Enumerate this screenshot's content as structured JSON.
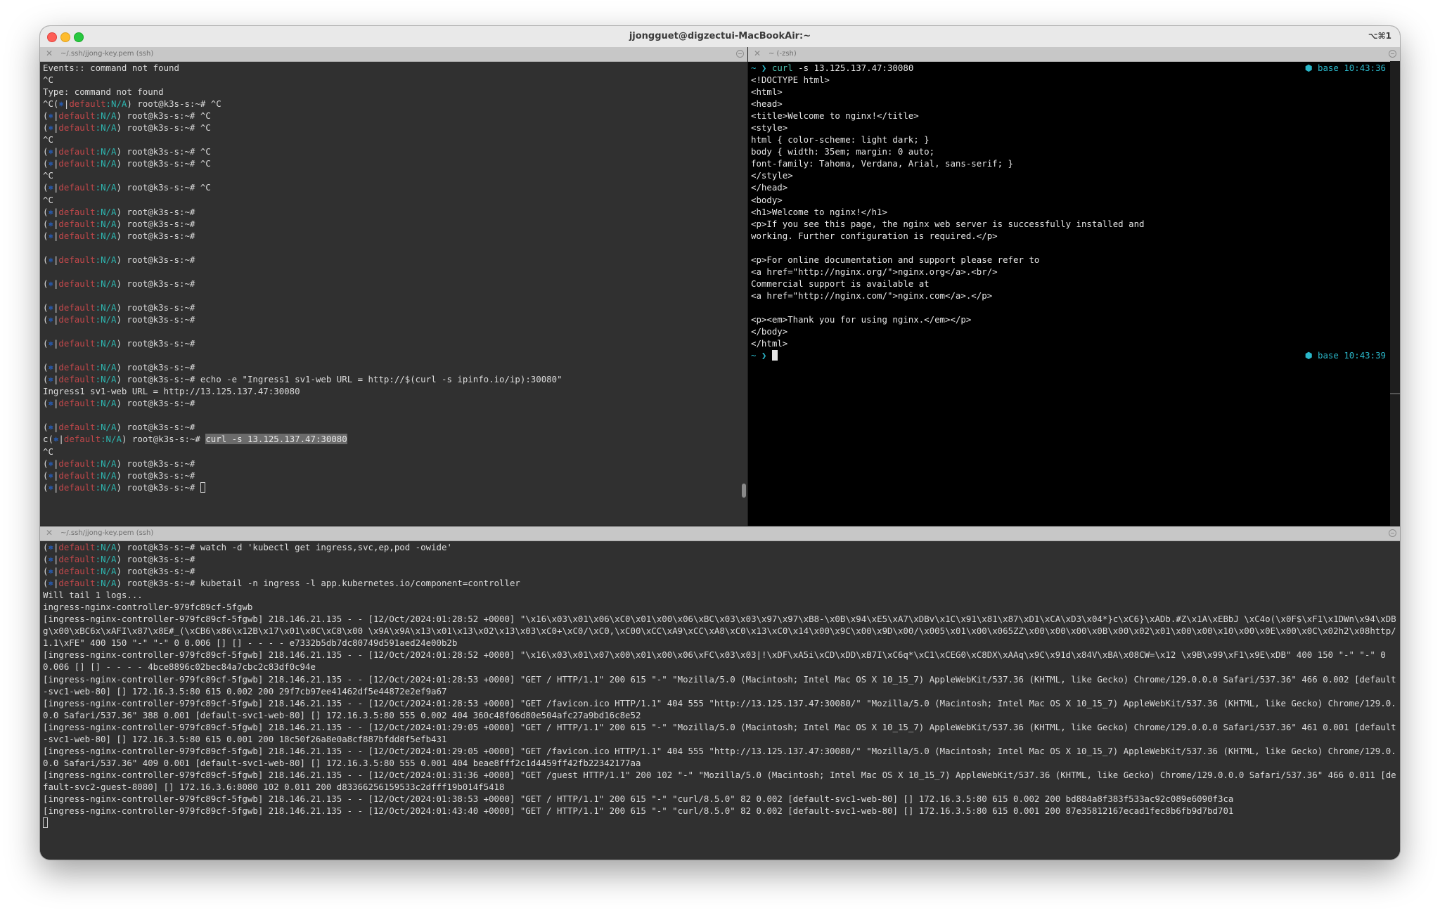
{
  "window": {
    "title": "jjongguet@digzectui-MacBookAir:~",
    "shortcut": "⌥⌘1"
  },
  "prompt": {
    "ctx_symbol": "⎈",
    "namespace": "default",
    "ns_suffix": ":N/A",
    "host": "root@k3s-s:~#"
  },
  "pane_left": {
    "tab_title": "~/.ssh/jjong-key.pem (ssh)",
    "pre_lines": [
      "Events:: command not found",
      "^C",
      "Type: command not found"
    ],
    "line4_prefix": "^C",
    "line4_suffix": " ^C",
    "after_c1": " ^C",
    "after_c2": " ^C",
    "echo_cmd": " echo -e \"Ingress1 sv1-web URL = http://$(curl -s ipinfo.io/ip):30080\"",
    "echo_output": "Ingress1 sv1-web URL = http://13.125.137.47:30080",
    "c_prefix": "c",
    "curl_cmd": "curl -s 13.125.137.47:30080",
    "ctrl_c": "^C"
  },
  "pane_right": {
    "tab_title": "~ (-zsh)",
    "prompt_symbol": "~ ❯",
    "command_name": "curl",
    "command_args": " -s 13.125.137.47:30080",
    "rprompt_env": "base",
    "rprompt_time1": "10:43:36",
    "rprompt_time2": "10:43:39",
    "html_lines": [
      "<!DOCTYPE html>",
      "<html>",
      "<head>",
      "<title>Welcome to nginx!</title>",
      "<style>",
      "html { color-scheme: light dark; }",
      "body { width: 35em; margin: 0 auto;",
      "font-family: Tahoma, Verdana, Arial, sans-serif; }",
      "</style>",
      "</head>",
      "<body>",
      "<h1>Welcome to nginx!</h1>",
      "<p>If you see this page, the nginx web server is successfully installed and",
      "working. Further configuration is required.</p>",
      "",
      "<p>For online documentation and support please refer to",
      "<a href=\"http://nginx.org/\">nginx.org</a>.<br/>",
      "Commercial support is available at",
      "<a href=\"http://nginx.com/\">nginx.com</a>.</p>",
      "",
      "<p><em>Thank you for using nginx.</em></p>",
      "</body>",
      "</html>"
    ]
  },
  "pane_bottom": {
    "tab_title": "~/.ssh/jjong-key.pem (ssh)",
    "watch_cmd": " watch -d 'kubectl get ingress,svc,ep,pod -owide'",
    "kubetail_cmd": " kubetail -n ingress -l app.kubernetes.io/component=controller",
    "log_lines": [
      "Will tail 1 logs...",
      "ingress-nginx-controller-979fc89cf-5fgwb",
      "[ingress-nginx-controller-979fc89cf-5fgwb] 218.146.21.135 - - [12/Oct/2024:01:28:52 +0000] \"\\x16\\x03\\x01\\x06\\xC0\\x01\\x00\\x06\\xBC\\x03\\x03\\x97\\x97\\xB8-\\x0B\\x94\\xE5\\xA7\\xDBv\\x1C\\x91\\x81\\x87\\xD1\\xCA\\xD3\\x04*}c\\xC6}\\xADb.#Z\\x1A\\xEBbJ \\xC4o(\\x0F$\\xF1\\x1DWn\\x94\\xDBg\\x00\\xBC6x\\xAFI\\x87\\x8E#_(\\xCB6\\x86\\x12B\\x17\\x01\\x0C\\xC8\\x00 \\x9A\\x9A\\x13\\x01\\x13\\x02\\x13\\x03\\xC0+\\xC0/\\xC0,\\xC00\\xCC\\xA9\\xCC\\xA8\\xC0\\x13\\xC0\\x14\\x00\\x9C\\x00\\x9D\\x00/\\x005\\x01\\x00\\x065ZZ\\x00\\x00\\x00\\x0B\\x00\\x02\\x01\\x00\\x00\\x10\\x00\\x0E\\x00\\x0C\\x02h2\\x08http/1.1\\xFE\" 400 150 \"-\" \"-\" 0 0.006 [] [] - - - - e7332b5db7dc80749d591aed24e00b2b",
      "[ingress-nginx-controller-979fc89cf-5fgwb] 218.146.21.135 - - [12/Oct/2024:01:28:52 +0000] \"\\x16\\x03\\x01\\x07\\x00\\x01\\x00\\x06\\xFC\\x03\\x03|!\\xDF\\xA5i\\xCD\\xDD\\xB7I\\xC6q*\\xC1\\xCEG0\\xC8DX\\xAAq\\x9C\\x91d\\x84V\\xBA\\x08CW=\\x12 \\x9B\\x99\\xF1\\x9E\\xDB\" 400 150 \"-\" \"-\" 0 0.006 [] [] - - - - 4bce8896c02bec84a7cbc2c83df0c94e",
      "[ingress-nginx-controller-979fc89cf-5fgwb] 218.146.21.135 - - [12/Oct/2024:01:28:53 +0000] \"GET / HTTP/1.1\" 200 615 \"-\" \"Mozilla/5.0 (Macintosh; Intel Mac OS X 10_15_7) AppleWebKit/537.36 (KHTML, like Gecko) Chrome/129.0.0.0 Safari/537.36\" 466 0.002 [default-svc1-web-80] [] 172.16.3.5:80 615 0.002 200 29f7cb97ee41462df5e44872e2ef9a67",
      "[ingress-nginx-controller-979fc89cf-5fgwb] 218.146.21.135 - - [12/Oct/2024:01:28:53 +0000] \"GET /favicon.ico HTTP/1.1\" 404 555 \"http://13.125.137.47:30080/\" \"Mozilla/5.0 (Macintosh; Intel Mac OS X 10_15_7) AppleWebKit/537.36 (KHTML, like Gecko) Chrome/129.0.0.0 Safari/537.36\" 388 0.001 [default-svc1-web-80] [] 172.16.3.5:80 555 0.002 404 360c48f06d80e504afc27a9bd16c8e52",
      "[ingress-nginx-controller-979fc89cf-5fgwb] 218.146.21.135 - - [12/Oct/2024:01:29:05 +0000] \"GET / HTTP/1.1\" 200 615 \"-\" \"Mozilla/5.0 (Macintosh; Intel Mac OS X 10_15_7) AppleWebKit/537.36 (KHTML, like Gecko) Chrome/129.0.0.0 Safari/537.36\" 461 0.001 [default-svc1-web-80] [] 172.16.3.5:80 615 0.001 200 18c50f26a8e0a8cf887bfdd8f5efb431",
      "[ingress-nginx-controller-979fc89cf-5fgwb] 218.146.21.135 - - [12/Oct/2024:01:29:05 +0000] \"GET /favicon.ico HTTP/1.1\" 404 555 \"http://13.125.137.47:30080/\" \"Mozilla/5.0 (Macintosh; Intel Mac OS X 10_15_7) AppleWebKit/537.36 (KHTML, like Gecko) Chrome/129.0.0.0 Safari/537.36\" 409 0.001 [default-svc1-web-80] [] 172.16.3.5:80 555 0.001 404 beae8fff2c1d4459ff42fb22342177aa",
      "[ingress-nginx-controller-979fc89cf-5fgwb] 218.146.21.135 - - [12/Oct/2024:01:31:36 +0000] \"GET /guest HTTP/1.1\" 200 102 \"-\" \"Mozilla/5.0 (Macintosh; Intel Mac OS X 10_15_7) AppleWebKit/537.36 (KHTML, like Gecko) Chrome/129.0.0.0 Safari/537.36\" 466 0.011 [default-svc2-guest-8080] [] 172.16.3.6:8080 102 0.011 200 d83366256159533c2dfff19b014f5418",
      "[ingress-nginx-controller-979fc89cf-5fgwb] 218.146.21.135 - - [12/Oct/2024:01:38:53 +0000] \"GET / HTTP/1.1\" 200 615 \"-\" \"curl/8.5.0\" 82 0.002 [default-svc1-web-80] [] 172.16.3.5:80 615 0.002 200 bd884a8f383f533ac92c089e6090f3ca",
      "[ingress-nginx-controller-979fc89cf-5fgwb] 218.146.21.135 - - [12/Oct/2024:01:43:40 +0000] \"GET / HTTP/1.1\" 200 615 \"-\" \"curl/8.5.0\" 82 0.002 [default-svc1-web-80] [] 172.16.3.5:80 615 0.001 200 87e35812167ecad1fec8b6fb9d7bd701"
    ]
  }
}
